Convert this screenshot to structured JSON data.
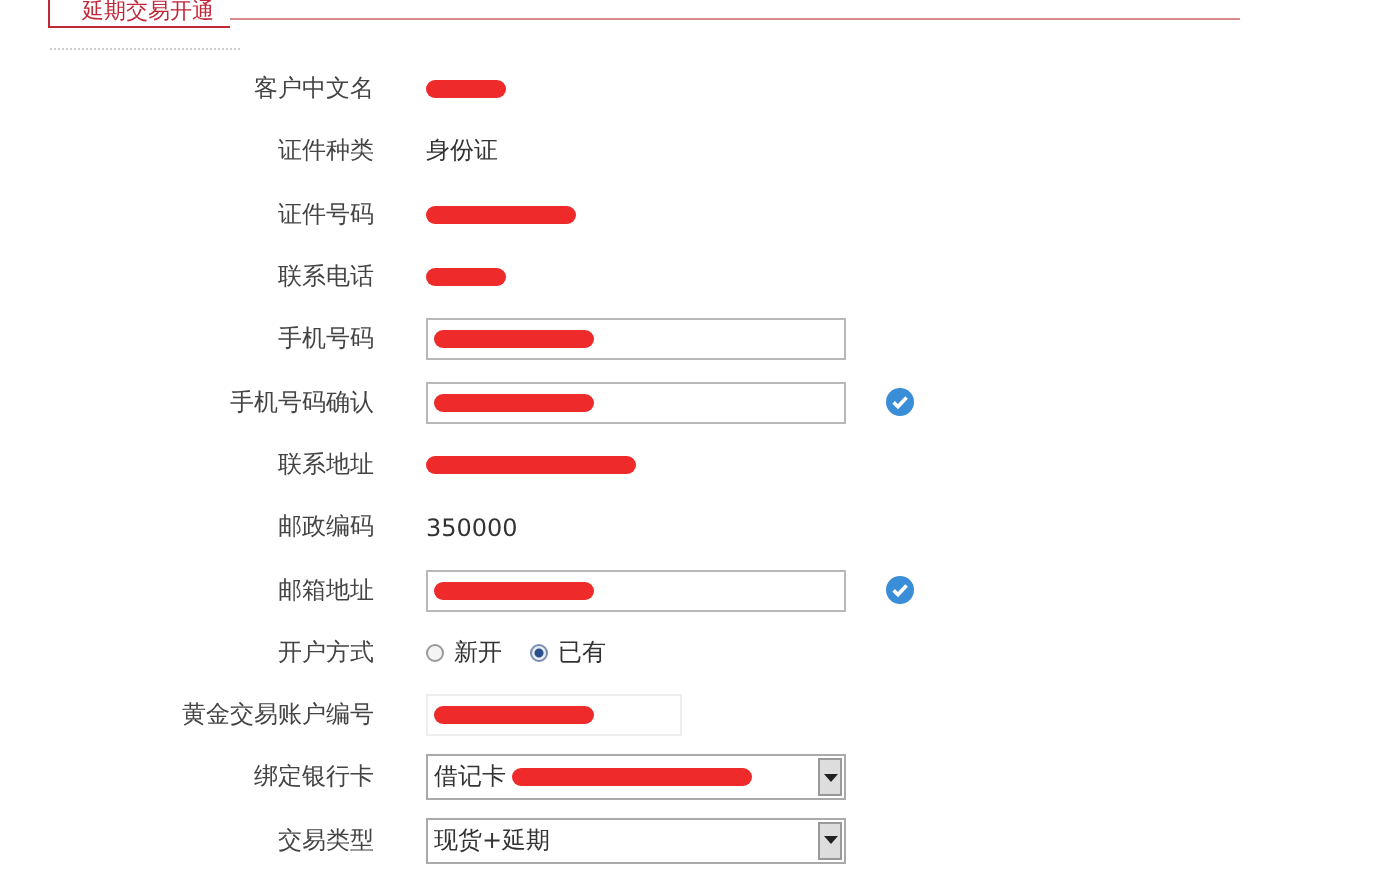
{
  "title": "延期交易开通",
  "fields": [
    {
      "label": "客户中文名",
      "kind": "redacted"
    },
    {
      "label": "证件种类",
      "kind": "text",
      "value": "身份证"
    },
    {
      "label": "证件号码",
      "kind": "redacted"
    },
    {
      "label": "联系电话",
      "kind": "redacted"
    },
    {
      "label": "手机号码",
      "kind": "input"
    },
    {
      "label": "手机号码确认",
      "kind": "input",
      "verified": true
    },
    {
      "label": "联系地址",
      "kind": "redacted"
    },
    {
      "label": "邮政编码",
      "kind": "text",
      "value": "350000"
    },
    {
      "label": "邮箱地址",
      "kind": "input",
      "verified": true
    },
    {
      "label": "开户方式",
      "kind": "radio",
      "options": [
        {
          "label": "新开",
          "selected": false
        },
        {
          "label": "已有",
          "selected": true
        }
      ]
    },
    {
      "label": "黄金交易账户编号",
      "kind": "short-input"
    },
    {
      "label": "绑定银行卡",
      "kind": "select",
      "value": "借记卡"
    },
    {
      "label": "交易类型",
      "kind": "select",
      "value": "现货+延期"
    }
  ]
}
